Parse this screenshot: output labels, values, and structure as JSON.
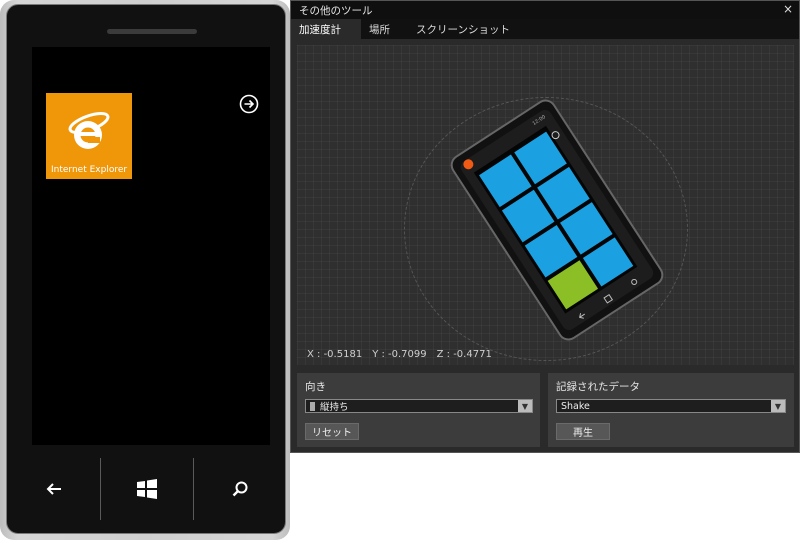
{
  "emulator": {
    "tile_label": "Internet Explorer",
    "tile_color": "#f09609",
    "icons": {
      "back": "back-arrow-icon",
      "start": "windows-logo-icon",
      "search": "search-icon",
      "next": "arrow-right-circle-icon"
    }
  },
  "tools": {
    "title": "その他のツール",
    "close_label": "×",
    "tabs": [
      "加速度計",
      "場所",
      "スクリーンショット"
    ],
    "active_tab": "加速度計",
    "readout": {
      "x": "X : -0.5181",
      "y": "Y : -0.7099",
      "z": "Z : -0.4771"
    },
    "orientation": {
      "label": "向き",
      "selected": "縦持ち",
      "reset_label": "リセット"
    },
    "recorded": {
      "label": "記録されたデータ",
      "selected": "Shake",
      "play_label": "再生"
    },
    "colors": {
      "tile_blue": "#1ba1e2",
      "tile_green": "#8cbf26",
      "dot_orange": "#f05a14"
    }
  }
}
